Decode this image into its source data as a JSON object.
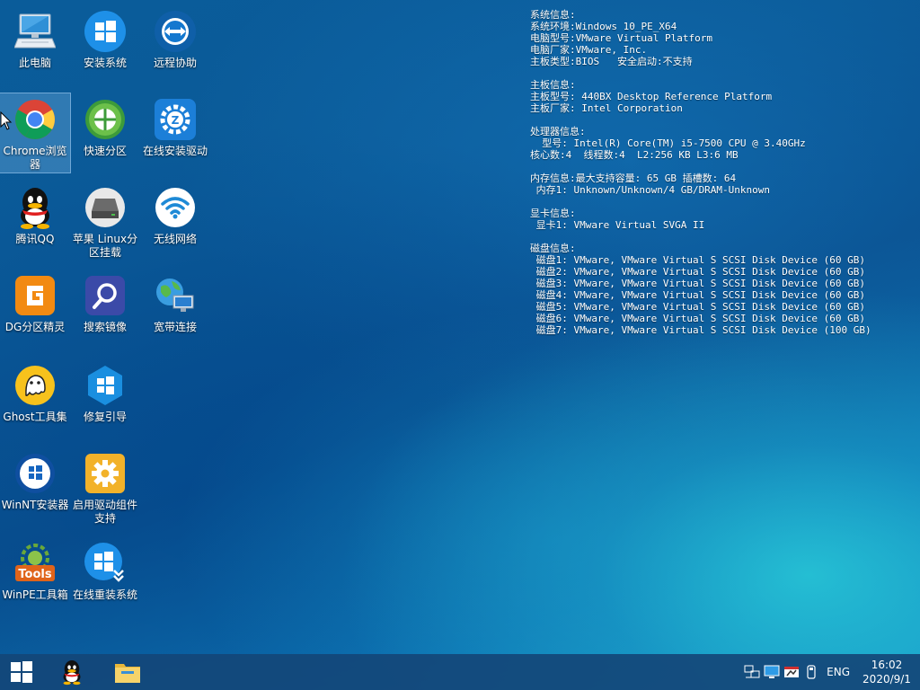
{
  "desktop": {
    "icons": [
      {
        "label": "此电脑",
        "icon": "computer-icon"
      },
      {
        "label": "安装系统",
        "icon": "windows-icon"
      },
      {
        "label": "远程协助",
        "icon": "teamviewer-icon"
      },
      {
        "label": "Chrome浏览器",
        "icon": "chrome-icon"
      },
      {
        "label": "快速分区",
        "icon": "partition-icon"
      },
      {
        "label": "在线安装驱动",
        "icon": "driver-icon"
      },
      {
        "label": "腾讯QQ",
        "icon": "qq-icon"
      },
      {
        "label": "苹果 Linux分区挂载",
        "icon": "disk-drive-icon"
      },
      {
        "label": "无线网络",
        "icon": "wifi-icon"
      },
      {
        "label": "DG分区精灵",
        "icon": "diskgenius-icon"
      },
      {
        "label": "搜索镜像",
        "icon": "search-icon"
      },
      {
        "label": "宽带连接",
        "icon": "globe-network-icon"
      },
      {
        "label": "Ghost工具集",
        "icon": "ghost-icon"
      },
      {
        "label": "修复引导",
        "icon": "repair-boot-icon"
      },
      {
        "label": "WinNT安装器",
        "icon": "winnt-icon"
      },
      {
        "label": "启用驱动组件支持",
        "icon": "gear-icon"
      },
      {
        "label": "WinPE工具箱",
        "icon": "tools-icon"
      },
      {
        "label": "在线重装系统",
        "icon": "reinstall-icon"
      }
    ]
  },
  "sysinfo": {
    "lines": [
      "系统信息:",
      "系统环境:Windows 10_PE_X64",
      "电脑型号:VMware Virtual Platform",
      "电脑厂家:VMware, Inc.",
      "主板类型:BIOS   安全启动:不支持",
      "",
      "主板信息:",
      "主板型号: 440BX Desktop Reference Platform",
      "主板厂家: Intel Corporation",
      "",
      "处理器信息:",
      "  型号: Intel(R) Core(TM) i5-7500 CPU @ 3.40GHz",
      "核心数:4  线程数:4  L2:256 KB L3:6 MB",
      "",
      "内存信息:最大支持容量: 65 GB 插槽数: 64",
      " 内存1: Unknown/Unknown/4 GB/DRAM-Unknown",
      "",
      "显卡信息:",
      " 显卡1: VMware Virtual SVGA II",
      "",
      "磁盘信息:",
      " 磁盘1: VMware, VMware Virtual S SCSI Disk Device (60 GB)",
      " 磁盘2: VMware, VMware Virtual S SCSI Disk Device (60 GB)",
      " 磁盘3: VMware, VMware Virtual S SCSI Disk Device (60 GB)",
      " 磁盘4: VMware, VMware Virtual S SCSI Disk Device (60 GB)",
      " 磁盘5: VMware, VMware Virtual S SCSI Disk Device (60 GB)",
      " 磁盘6: VMware, VMware Virtual S SCSI Disk Device (60 GB)",
      " 磁盘7: VMware, VMware Virtual S SCSI Disk Device (100 GB)"
    ]
  },
  "taskbar": {
    "pinned": [
      "start-icon",
      "qq-icon",
      "file-explorer-icon"
    ],
    "tray": {
      "language": "ENG",
      "time": "16:02",
      "date": "2020/9/1"
    }
  }
}
